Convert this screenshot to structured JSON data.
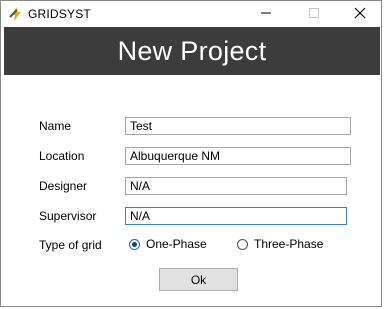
{
  "window": {
    "title": "GRIDSYST",
    "app_icon": "lightning-bolt-icon",
    "controls": {
      "minimize_icon": "minimize-icon",
      "maximize_icon": "maximize-icon",
      "close_icon": "close-icon"
    }
  },
  "header": {
    "title": "New Project",
    "background": "#3c3c3c",
    "color": "#ffffff"
  },
  "form": {
    "name_label": "Name",
    "name_value": "Test",
    "location_label": "Location",
    "location_value": "Albuquerque NM",
    "designer_label": "Designer",
    "designer_value": "N/A",
    "supervisor_label": "Supervisor",
    "supervisor_value": "N/A",
    "grid_type_label": "Type of grid",
    "grid_options": [
      {
        "label": "One-Phase",
        "selected": true
      },
      {
        "label": "Three-Phase",
        "selected": false
      }
    ]
  },
  "actions": {
    "ok_label": "Ok"
  },
  "colors": {
    "focus_border": "#3a7bd5",
    "radio_selected": "#1a6fd8"
  }
}
